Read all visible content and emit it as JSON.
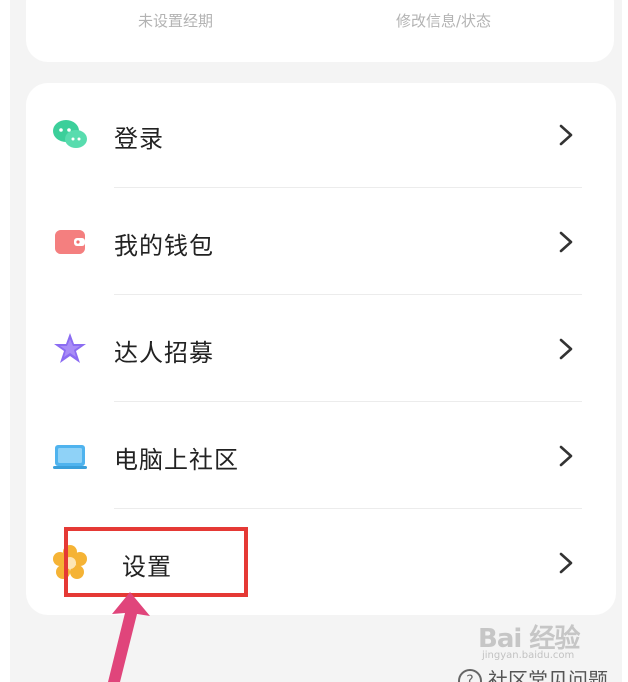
{
  "top_card": {
    "left_label": "未设置经期",
    "right_label": "修改信息/状态"
  },
  "menu": {
    "items": [
      {
        "label": "登录",
        "icon": "wechat-chat-icon",
        "color": "#3ccf9a"
      },
      {
        "label": "我的钱包",
        "icon": "wallet-icon",
        "color": "#f26f6f"
      },
      {
        "label": "达人招募",
        "icon": "star-icon",
        "color": "#8b6cf2"
      },
      {
        "label": "电脑上社区",
        "icon": "laptop-icon",
        "color": "#4fb3ee"
      },
      {
        "label": "设置",
        "icon": "gear-flower-icon",
        "color": "#f5b335"
      }
    ]
  },
  "footer": {
    "help_text": "社区常见问题",
    "help_icon": "question-circle-icon"
  },
  "watermark": {
    "text": "Bai 经验",
    "sub": "jingyan.baidu.com"
  },
  "annotation": {
    "box_color": "#e53935",
    "arrow_color": "#e0457b"
  }
}
